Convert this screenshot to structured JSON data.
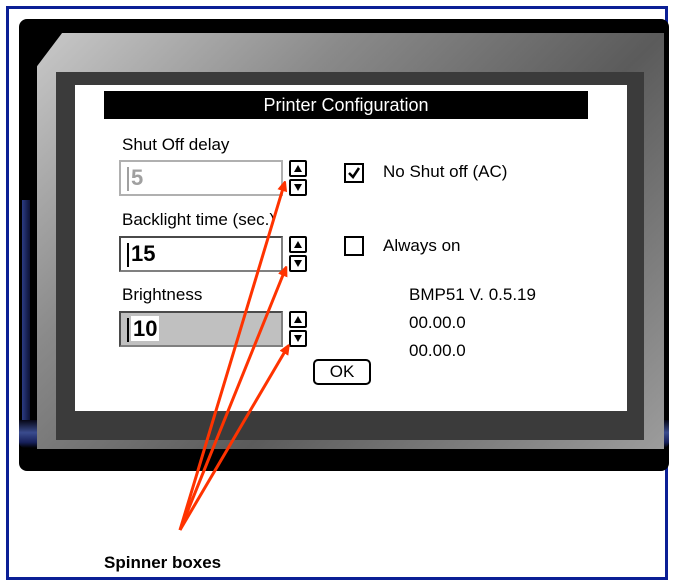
{
  "dialog": {
    "title": "Printer Configuration",
    "shut_off_delay": {
      "label": "Shut Off delay",
      "value": "5",
      "enabled": false
    },
    "backlight_time": {
      "label": "Backlight time (sec.)",
      "value": "15"
    },
    "brightness": {
      "label": "Brightness",
      "value": "10",
      "selected": true
    },
    "no_shut_off": {
      "label": "No Shut off (AC)",
      "checked": true
    },
    "always_on": {
      "label": "Always on",
      "checked": false
    },
    "version_lines": [
      "BMP51 V. 0.5.19",
      "00.00.0",
      "00.00.0"
    ],
    "ok_label": "OK"
  },
  "callout": {
    "caption": "Spinner boxes",
    "color": "#ff3300"
  },
  "colors": {
    "border": "#0b1f95",
    "titlebar": "#000000"
  }
}
